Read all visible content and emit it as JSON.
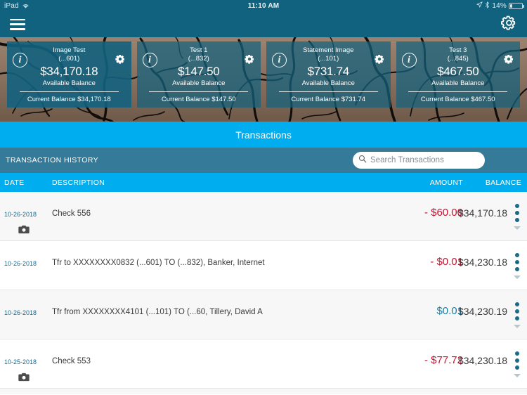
{
  "status_bar": {
    "device": "iPad",
    "wifi_icon": "wifi-icon",
    "time": "11:10 AM",
    "location_icon": "location-arrow-icon",
    "bluetooth_icon": "bluetooth-icon",
    "battery_percent": "14%",
    "battery_icon": "battery-icon"
  },
  "navbar": {
    "menu_icon": "hamburger-menu-icon",
    "settings_icon": "gear-icon"
  },
  "accounts": [
    {
      "name": "Image Test",
      "number": "(...601)",
      "available_amount": "$34,170.18",
      "available_label": "Available Balance",
      "current_balance": "Current Balance $34,170.18",
      "info_icon": "info-icon",
      "gear_icon": "gear-icon"
    },
    {
      "name": "Test 1",
      "number": "(...832)",
      "available_amount": "$147.50",
      "available_label": "Available Balance",
      "current_balance": "Current Balance $147.50",
      "info_icon": "info-icon",
      "gear_icon": "gear-icon"
    },
    {
      "name": "Statement Image",
      "number": "(...101)",
      "available_amount": "$731.74",
      "available_label": "Available Balance",
      "current_balance": "Current Balance $731.74",
      "info_icon": "info-icon",
      "gear_icon": "gear-icon"
    },
    {
      "name": "Test 3",
      "number": "(...845)",
      "available_amount": "$467.50",
      "available_label": "Available Balance",
      "current_balance": "Current Balance $467.50",
      "info_icon": "info-icon",
      "gear_icon": "gear-icon"
    }
  ],
  "transactions_title": "Transactions",
  "history": {
    "label": "TRANSACTION HISTORY",
    "search_placeholder": "Search Transactions",
    "search_value": "",
    "search_icon": "search-icon"
  },
  "columns": {
    "date": "DATE",
    "description": "DESCRIPTION",
    "amount": "AMOUNT",
    "balance": "BALANCE"
  },
  "rows": [
    {
      "date": "10-26-2018",
      "description": "Check 556",
      "amount": "- $60.00",
      "amount_sign": "negative",
      "balance": "$34,170.18",
      "has_camera": true
    },
    {
      "date": "10-26-2018",
      "description": "Tfr to XXXXXXXX0832 (...601) TO (...832), Banker, Internet",
      "amount": "- $0.01",
      "amount_sign": "negative",
      "balance": "$34,230.18",
      "has_camera": false
    },
    {
      "date": "10-26-2018",
      "description": "Tfr from XXXXXXXX4101 (...101) TO (...60, Tillery, David A",
      "amount": "$0.01",
      "amount_sign": "positive",
      "balance": "$34,230.19",
      "has_camera": false
    },
    {
      "date": "10-25-2018",
      "description": "Check 553",
      "amount": "- $77.72",
      "amount_sign": "negative",
      "balance": "$34,230.18",
      "has_camera": true
    }
  ],
  "colors": {
    "header": "#11627e",
    "accent_blue": "#00AEEF",
    "band_teal": "#357a99",
    "card_teal": "#13627e",
    "negative": "#c8102e",
    "positive": "#1880a5",
    "date_text": "#1a6a8a"
  }
}
